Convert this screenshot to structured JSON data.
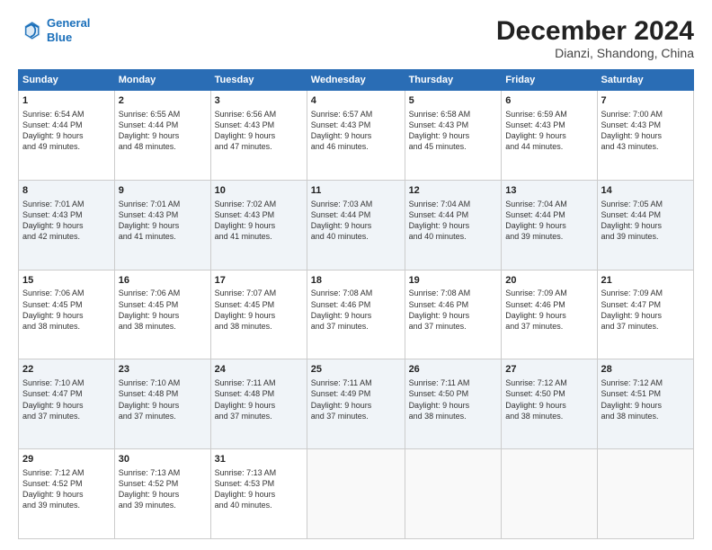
{
  "header": {
    "logo_line1": "General",
    "logo_line2": "Blue",
    "title": "December 2024",
    "subtitle": "Dianzi, Shandong, China"
  },
  "days_of_week": [
    "Sunday",
    "Monday",
    "Tuesday",
    "Wednesday",
    "Thursday",
    "Friday",
    "Saturday"
  ],
  "weeks": [
    [
      {
        "day": "1",
        "info": "Sunrise: 6:54 AM\nSunset: 4:44 PM\nDaylight: 9 hours\nand 49 minutes."
      },
      {
        "day": "2",
        "info": "Sunrise: 6:55 AM\nSunset: 4:44 PM\nDaylight: 9 hours\nand 48 minutes."
      },
      {
        "day": "3",
        "info": "Sunrise: 6:56 AM\nSunset: 4:43 PM\nDaylight: 9 hours\nand 47 minutes."
      },
      {
        "day": "4",
        "info": "Sunrise: 6:57 AM\nSunset: 4:43 PM\nDaylight: 9 hours\nand 46 minutes."
      },
      {
        "day": "5",
        "info": "Sunrise: 6:58 AM\nSunset: 4:43 PM\nDaylight: 9 hours\nand 45 minutes."
      },
      {
        "day": "6",
        "info": "Sunrise: 6:59 AM\nSunset: 4:43 PM\nDaylight: 9 hours\nand 44 minutes."
      },
      {
        "day": "7",
        "info": "Sunrise: 7:00 AM\nSunset: 4:43 PM\nDaylight: 9 hours\nand 43 minutes."
      }
    ],
    [
      {
        "day": "8",
        "info": "Sunrise: 7:01 AM\nSunset: 4:43 PM\nDaylight: 9 hours\nand 42 minutes."
      },
      {
        "day": "9",
        "info": "Sunrise: 7:01 AM\nSunset: 4:43 PM\nDaylight: 9 hours\nand 41 minutes."
      },
      {
        "day": "10",
        "info": "Sunrise: 7:02 AM\nSunset: 4:43 PM\nDaylight: 9 hours\nand 41 minutes."
      },
      {
        "day": "11",
        "info": "Sunrise: 7:03 AM\nSunset: 4:44 PM\nDaylight: 9 hours\nand 40 minutes."
      },
      {
        "day": "12",
        "info": "Sunrise: 7:04 AM\nSunset: 4:44 PM\nDaylight: 9 hours\nand 40 minutes."
      },
      {
        "day": "13",
        "info": "Sunrise: 7:04 AM\nSunset: 4:44 PM\nDaylight: 9 hours\nand 39 minutes."
      },
      {
        "day": "14",
        "info": "Sunrise: 7:05 AM\nSunset: 4:44 PM\nDaylight: 9 hours\nand 39 minutes."
      }
    ],
    [
      {
        "day": "15",
        "info": "Sunrise: 7:06 AM\nSunset: 4:45 PM\nDaylight: 9 hours\nand 38 minutes."
      },
      {
        "day": "16",
        "info": "Sunrise: 7:06 AM\nSunset: 4:45 PM\nDaylight: 9 hours\nand 38 minutes."
      },
      {
        "day": "17",
        "info": "Sunrise: 7:07 AM\nSunset: 4:45 PM\nDaylight: 9 hours\nand 38 minutes."
      },
      {
        "day": "18",
        "info": "Sunrise: 7:08 AM\nSunset: 4:46 PM\nDaylight: 9 hours\nand 37 minutes."
      },
      {
        "day": "19",
        "info": "Sunrise: 7:08 AM\nSunset: 4:46 PM\nDaylight: 9 hours\nand 37 minutes."
      },
      {
        "day": "20",
        "info": "Sunrise: 7:09 AM\nSunset: 4:46 PM\nDaylight: 9 hours\nand 37 minutes."
      },
      {
        "day": "21",
        "info": "Sunrise: 7:09 AM\nSunset: 4:47 PM\nDaylight: 9 hours\nand 37 minutes."
      }
    ],
    [
      {
        "day": "22",
        "info": "Sunrise: 7:10 AM\nSunset: 4:47 PM\nDaylight: 9 hours\nand 37 minutes."
      },
      {
        "day": "23",
        "info": "Sunrise: 7:10 AM\nSunset: 4:48 PM\nDaylight: 9 hours\nand 37 minutes."
      },
      {
        "day": "24",
        "info": "Sunrise: 7:11 AM\nSunset: 4:48 PM\nDaylight: 9 hours\nand 37 minutes."
      },
      {
        "day": "25",
        "info": "Sunrise: 7:11 AM\nSunset: 4:49 PM\nDaylight: 9 hours\nand 37 minutes."
      },
      {
        "day": "26",
        "info": "Sunrise: 7:11 AM\nSunset: 4:50 PM\nDaylight: 9 hours\nand 38 minutes."
      },
      {
        "day": "27",
        "info": "Sunrise: 7:12 AM\nSunset: 4:50 PM\nDaylight: 9 hours\nand 38 minutes."
      },
      {
        "day": "28",
        "info": "Sunrise: 7:12 AM\nSunset: 4:51 PM\nDaylight: 9 hours\nand 38 minutes."
      }
    ],
    [
      {
        "day": "29",
        "info": "Sunrise: 7:12 AM\nSunset: 4:52 PM\nDaylight: 9 hours\nand 39 minutes."
      },
      {
        "day": "30",
        "info": "Sunrise: 7:13 AM\nSunset: 4:52 PM\nDaylight: 9 hours\nand 39 minutes."
      },
      {
        "day": "31",
        "info": "Sunrise: 7:13 AM\nSunset: 4:53 PM\nDaylight: 9 hours\nand 40 minutes."
      },
      null,
      null,
      null,
      null
    ]
  ]
}
